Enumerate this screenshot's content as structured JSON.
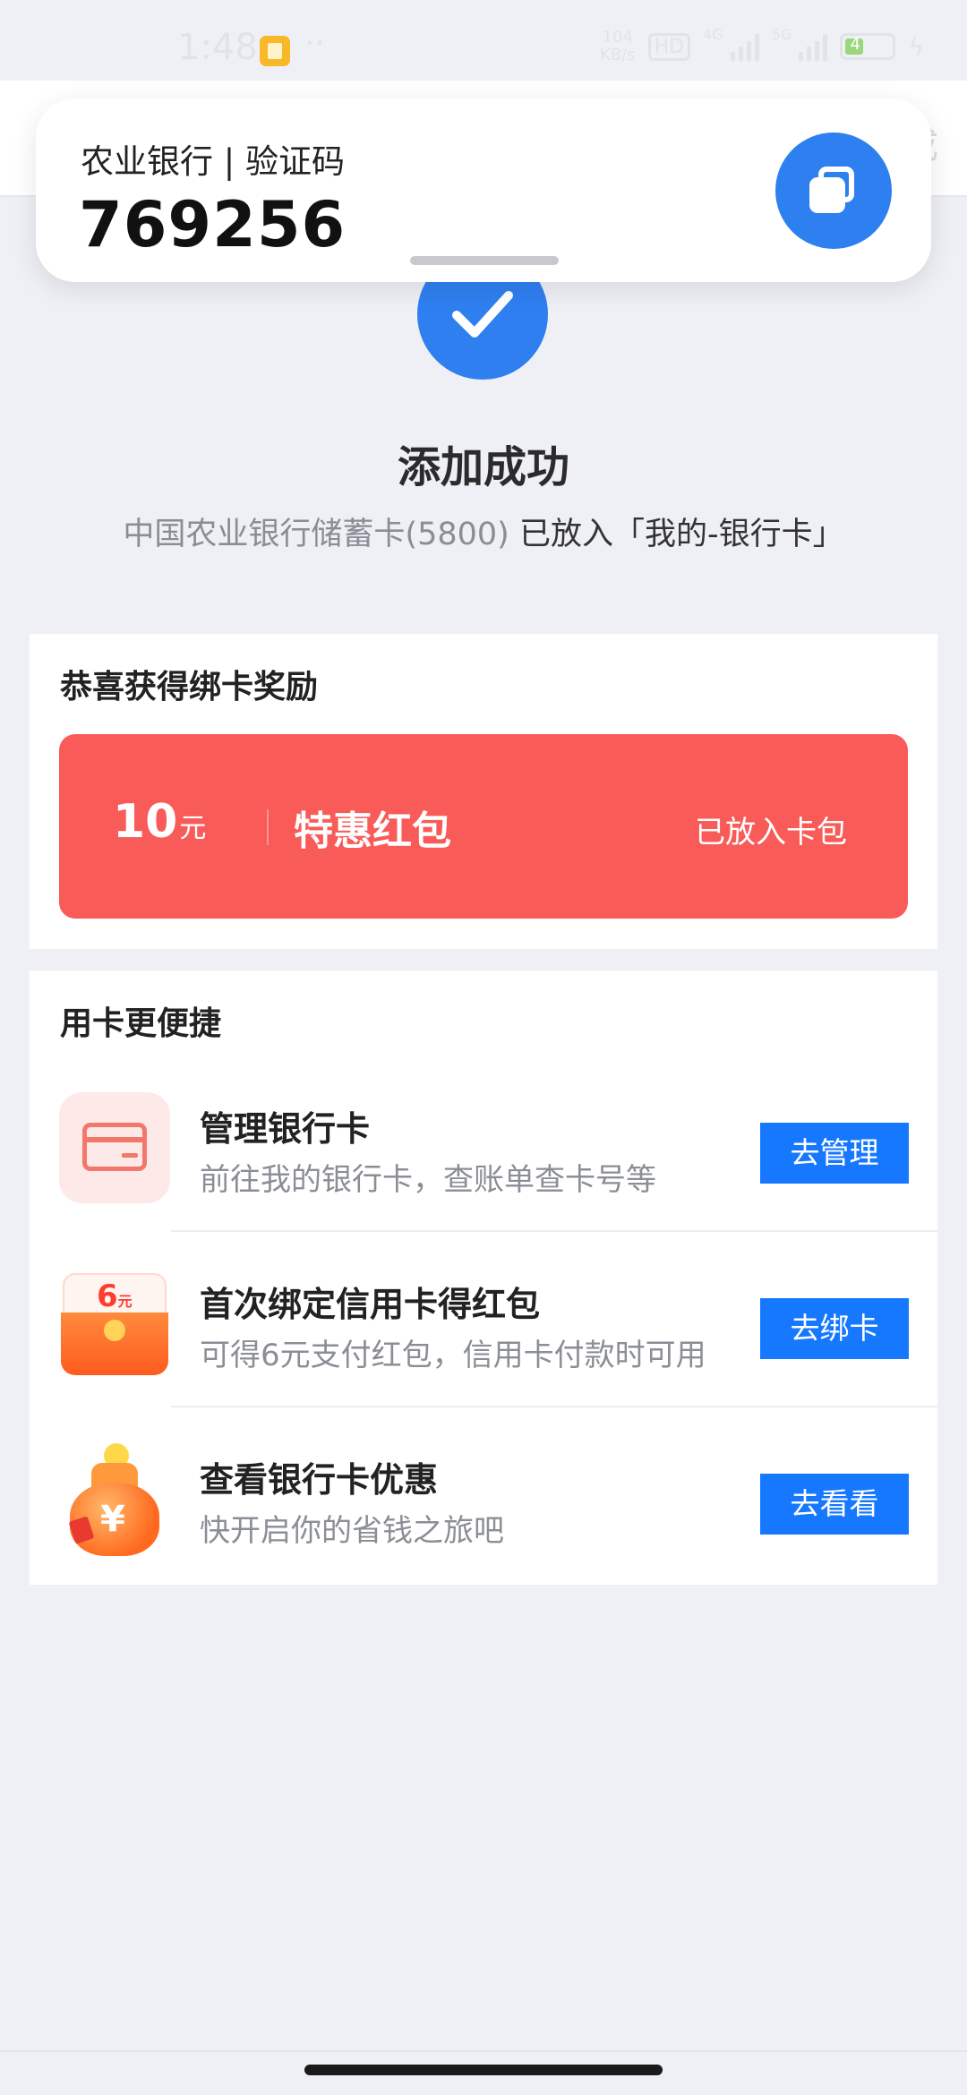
{
  "status_bar": {
    "time": "1:48",
    "more": "··",
    "net_speed_value": "104",
    "net_speed_unit": "KB/s",
    "hd": "HD",
    "sim1_label": "4G",
    "sim2_label": "5G",
    "battery": "4"
  },
  "nav": {
    "done_label": "完成"
  },
  "notification": {
    "title": "农业银行 | 验证码",
    "code": "769256"
  },
  "success": {
    "title": "添加成功",
    "desc_muted": "中国农业银行储蓄卡(5800)",
    "desc_main": " 已放入「我的-银行卡」"
  },
  "reward": {
    "section_title": "恭喜获得绑卡奖励",
    "amount": "10",
    "unit": "元",
    "name": "特惠红包",
    "status": "已放入卡包"
  },
  "convenience": {
    "section_title": "用卡更便捷",
    "items": [
      {
        "icon": "bank-card-icon",
        "title": "管理银行卡",
        "desc": "前往我的银行卡，查账单查卡号等",
        "button": "去管理"
      },
      {
        "icon": "red-envelope-icon",
        "badge_value": "6",
        "badge_unit": "元",
        "title": "首次绑定信用卡得红包",
        "desc": "可得6元支付红包，信用卡付款时可用",
        "button": "去绑卡"
      },
      {
        "icon": "money-bag-icon",
        "badge_value": "¥",
        "title": "查看银行卡优惠",
        "desc": "快开启你的省钱之旅吧",
        "button": "去看看"
      }
    ]
  },
  "colors": {
    "accent_blue": "#1677ff",
    "success_blue": "#2f7ff1",
    "reward_red": "#f85b58",
    "background": "#eef0f6"
  }
}
